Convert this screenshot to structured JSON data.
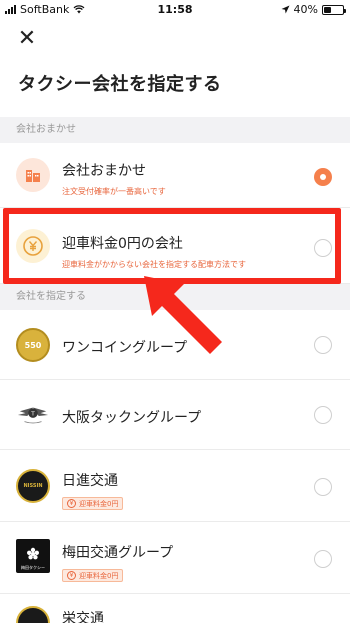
{
  "status_bar": {
    "carrier": "SoftBank",
    "time": "11:58",
    "battery": "40%"
  },
  "header": {
    "close_label": "✕",
    "title": "タクシー会社を指定する"
  },
  "sections": [
    {
      "label": "会社おまかせ"
    },
    {
      "label": "会社を指定する"
    }
  ],
  "options": [
    {
      "name": "会社おまかせ",
      "sub": "注文受付確率が一番高いです",
      "checked": true
    },
    {
      "name": "迎車料金0円の会社",
      "sub": "迎車料金がかからない会社を指定する配車方法です",
      "checked": false
    }
  ],
  "companies": [
    {
      "name": "ワンコイングループ",
      "logo_text": "550",
      "badge": ""
    },
    {
      "name": "大阪タックングループ",
      "logo_text": "",
      "badge": ""
    },
    {
      "name": "日進交通",
      "logo_text": "NISSIN",
      "badge": "迎車料金0円"
    },
    {
      "name": "梅田交通グループ",
      "logo_text": "梅田タクシー",
      "badge": "迎車料金0円"
    },
    {
      "name": "栄交通",
      "logo_text": "",
      "badge": ""
    }
  ],
  "colors": {
    "accent": "#f5804c",
    "sub_text": "#e8663d",
    "highlight": "#f5281c",
    "section_bg": "#f2f2f4"
  }
}
